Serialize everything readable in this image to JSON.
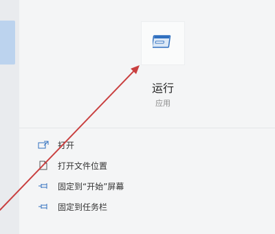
{
  "app": {
    "name": "运行",
    "type": "应用",
    "icon": "run-app-icon"
  },
  "actions": [
    {
      "label": "打开",
      "icon": "open-icon"
    },
    {
      "label": "打开文件位置",
      "icon": "file-location-icon"
    },
    {
      "label": "固定到“开始”屏幕",
      "icon": "pin-icon"
    },
    {
      "label": "固定到任务栏",
      "icon": "pin-icon"
    }
  ],
  "colors": {
    "accent": "#2f6fbf",
    "arrow": "#c94040",
    "panel": "#f4f5f6"
  }
}
